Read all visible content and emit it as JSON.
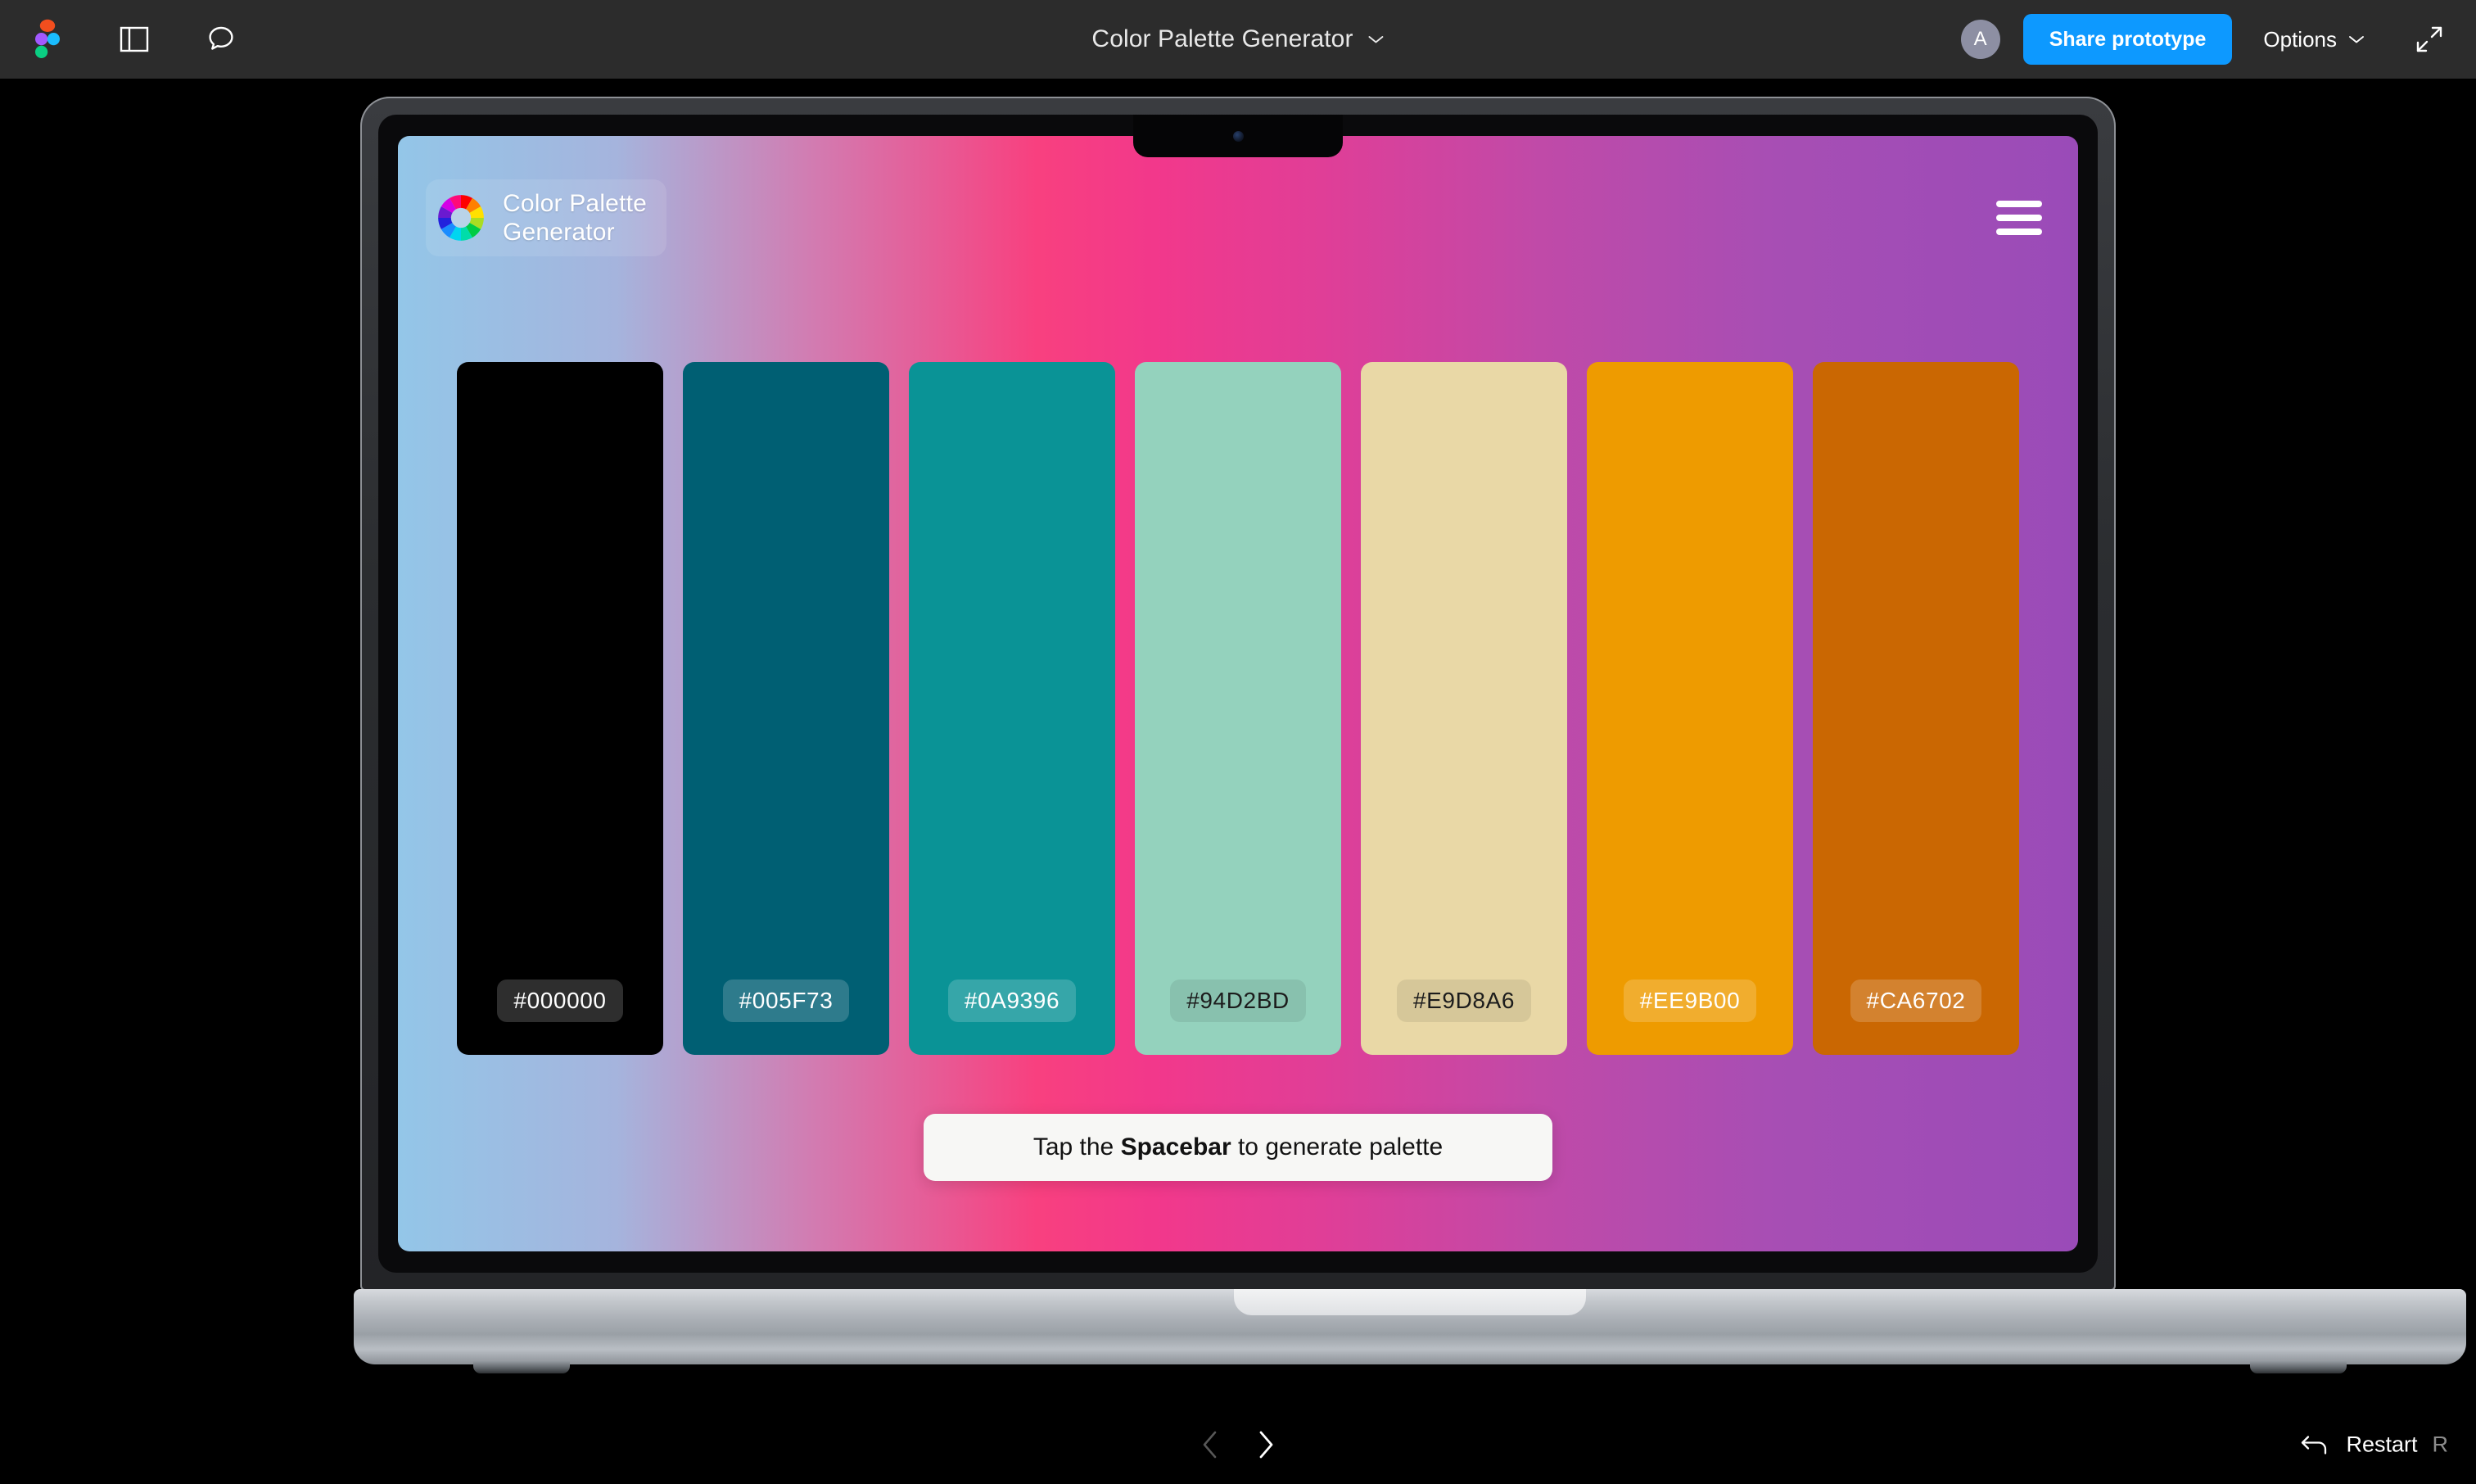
{
  "toolbar": {
    "figma_logo_name": "figma-logo",
    "panel_toggle_name": "layers-panel-toggle",
    "comment_name": "comment-tool",
    "title": "Color Palette Generator",
    "avatar_initial": "A",
    "share_label": "Share prototype",
    "options_label": "Options",
    "fullscreen_name": "fullscreen-icon",
    "accent_color": "#0d99ff",
    "bar_color": "#2c2c2c"
  },
  "app": {
    "brand_name": "Color Palette\nGenerator",
    "logo_icon": "color-wheel-icon",
    "menu_icon": "hamburger-menu-icon",
    "hint_prefix": "Tap the ",
    "hint_key": "Spacebar",
    "hint_suffix": " to generate palette",
    "gradient_stops": [
      "#93c6e8",
      "#f8407f",
      "#9a4bb8"
    ],
    "swatches": [
      {
        "hex": "#000000",
        "label": "#000000",
        "text_mode": "on-dark"
      },
      {
        "hex": "#005F73",
        "label": "#005F73",
        "text_mode": "on-dark"
      },
      {
        "hex": "#0A9396",
        "label": "#0A9396",
        "text_mode": "on-dark"
      },
      {
        "hex": "#94D2BD",
        "label": "#94D2BD",
        "text_mode": "on-light"
      },
      {
        "hex": "#E9D8A6",
        "label": "#E9D8A6",
        "text_mode": "on-light"
      },
      {
        "hex": "#EE9B00",
        "label": "#EE9B00",
        "text_mode": "on-dark"
      },
      {
        "hex": "#CA6702",
        "label": "#CA6702",
        "text_mode": "on-dark"
      }
    ]
  },
  "proto_bar": {
    "prev_name": "previous-frame-arrow",
    "next_name": "next-frame-arrow",
    "restart_icon": "restart-arrow-icon",
    "restart_label": "Restart",
    "restart_shortcut": "R"
  }
}
